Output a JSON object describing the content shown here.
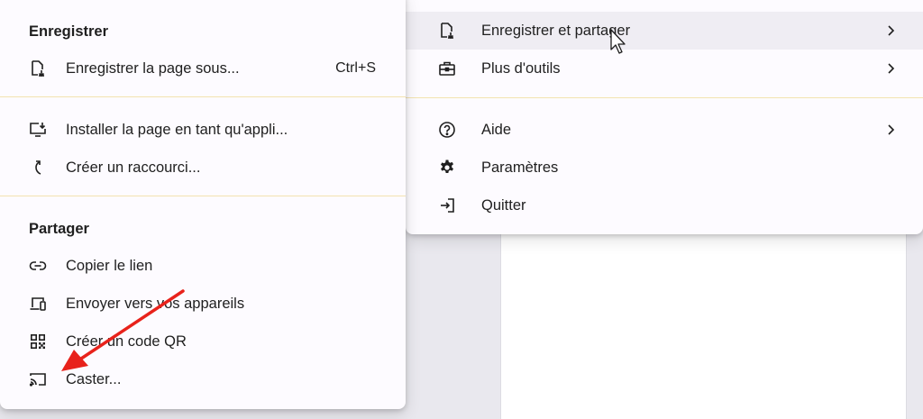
{
  "main_menu": {
    "items": [
      {
        "label": "Enregistrer et partager",
        "icon": "save-share-icon",
        "has_submenu": true,
        "highlighted": true
      },
      {
        "label": "Plus d'outils",
        "icon": "toolbox-icon",
        "has_submenu": true
      },
      {
        "label": "Aide",
        "icon": "help-icon",
        "has_submenu": true
      },
      {
        "label": "Paramètres",
        "icon": "gear-icon",
        "has_submenu": false
      },
      {
        "label": "Quitter",
        "icon": "exit-icon",
        "has_submenu": false
      }
    ]
  },
  "submenu": {
    "section_save": {
      "heading": "Enregistrer",
      "items": [
        {
          "label": "Enregistrer la page sous...",
          "shortcut": "Ctrl+S",
          "icon": "save-page-icon"
        }
      ]
    },
    "section_install": {
      "items": [
        {
          "label": "Installer la page en tant qu'appli...",
          "icon": "install-app-icon"
        },
        {
          "label": "Créer un raccourci...",
          "icon": "shortcut-icon"
        }
      ]
    },
    "section_share": {
      "heading": "Partager",
      "items": [
        {
          "label": "Copier le lien",
          "icon": "link-icon"
        },
        {
          "label": "Envoyer vers vos appareils",
          "icon": "devices-icon"
        },
        {
          "label": "Créer un code QR",
          "icon": "qr-code-icon"
        },
        {
          "label": "Caster...",
          "icon": "cast-icon"
        }
      ]
    }
  },
  "colors": {
    "menu_bg": "#fdfbff",
    "highlight_bg": "#efedf3",
    "separator": "#f3e3b0",
    "annotation_arrow": "#e8221b"
  }
}
